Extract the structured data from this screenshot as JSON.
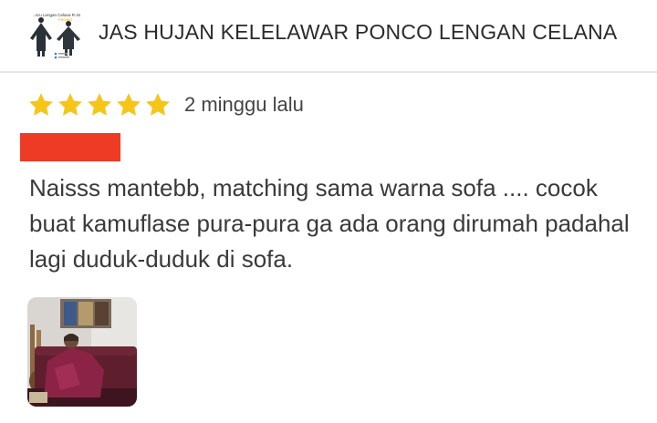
{
  "product": {
    "title": "JAS HUJAN KELELAWAR PONCO LENGAN CELANA",
    "thumbnail_icon": "raincoat-product-thumbnail"
  },
  "review": {
    "rating": 5,
    "rating_max": 5,
    "star_color": "#f5c518",
    "date": "2 minggu lalu",
    "reviewer_name_redacted_color": "#ee3b26",
    "text": "Naisss mantebb, matching sama warna sofa .... cocok buat kamuflase pura-pura ga ada orang dirumah padahal lagi duduk-duduk di sofa.",
    "photo_icon": "review-photo-person-in-raincoat-on-sofa"
  }
}
